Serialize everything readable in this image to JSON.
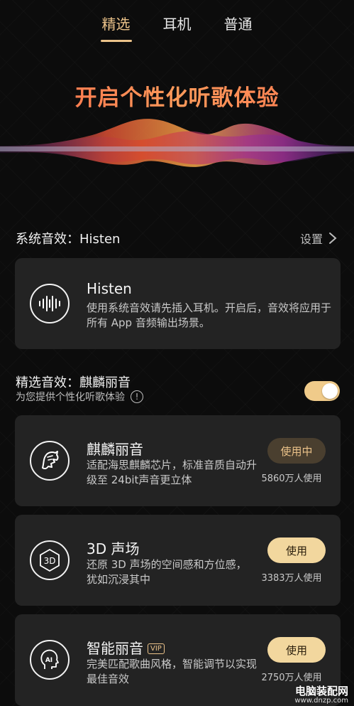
{
  "tabs": [
    {
      "label": "精选",
      "active": true
    },
    {
      "label": "耳机",
      "active": false
    },
    {
      "label": "普通",
      "active": false
    }
  ],
  "hero": {
    "title": "开启个性化听歌体验"
  },
  "system_effect": {
    "label": "系统音效：Histen",
    "settings_label": "设置",
    "card": {
      "title": "Histen",
      "description": "使用系统音效请先插入耳机。开启后，音效将应用于所有 App 音频输出场景。",
      "icon": "sound-wave-icon"
    }
  },
  "selected_effect": {
    "title": "精选音效：麒麟丽音",
    "subtitle": "为您提供个性化听歌体验",
    "info_symbol": "!",
    "toggle_on": true
  },
  "effects": [
    {
      "title": "麒麟丽音",
      "description": "适配海思麒麟芯片，标准音质自动升级至 24bit声音更立体",
      "button": "使用中",
      "in_use": true,
      "users": "5860万人使用",
      "icon": "kirin-icon",
      "vip": false
    },
    {
      "title": "3D 声场",
      "description": "还原 3D 声场的空间感和方位感，犹如沉浸其中",
      "button": "使用",
      "in_use": false,
      "users": "3383万人使用",
      "icon": "3d-sound-icon",
      "icon_text": "3D",
      "vip": false
    },
    {
      "title": "智能丽音",
      "description": "完美匹配歌曲风格，智能调节以实现最佳音效",
      "button": "使用",
      "in_use": false,
      "users": "2750万人使用",
      "icon": "ai-head-icon",
      "icon_text": "AI",
      "vip": true,
      "vip_label": "VIP"
    }
  ],
  "watermark": {
    "name": "电脑装配网",
    "url": "www.dnzp.com"
  },
  "colors": {
    "accent": "#ecc38a",
    "button": "#f2d79e",
    "card": "#232323",
    "hero": "#f47a52"
  }
}
